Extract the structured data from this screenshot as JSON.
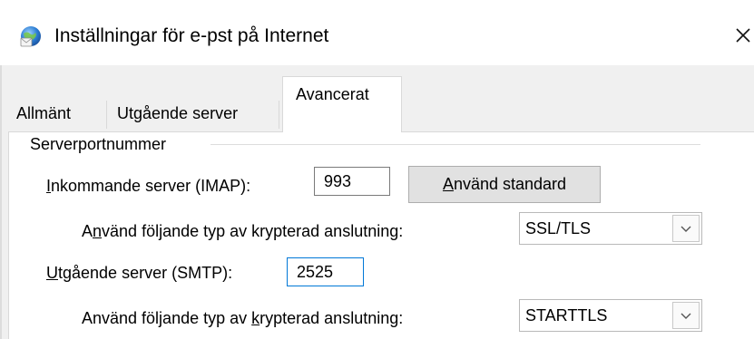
{
  "window": {
    "title": "Inställningar för e-pst på Internet",
    "icon": "globe-mail-icon",
    "close_glyph": "✕"
  },
  "tabs": [
    {
      "label": "Allmänt",
      "active": false
    },
    {
      "label": "Utgående server",
      "active": false
    },
    {
      "label": "Avancerat",
      "active": true
    }
  ],
  "group": {
    "label": "Serverportnummer"
  },
  "incoming": {
    "label_ul": "I",
    "label_rest": "nkommande server (IMAP):",
    "port": "993",
    "default_button_ul": "A",
    "default_button_rest": "nvänd standard",
    "encryption_label_pre": "A",
    "encryption_label_ul": "n",
    "encryption_label_post": "vänd följande typ av krypterad anslutning:",
    "encryption_value": "SSL/TLS"
  },
  "outgoing": {
    "label_ul": "U",
    "label_rest": "tgående server (SMTP):",
    "port": "2525",
    "encryption_label_pre": "Använd följande typ av ",
    "encryption_label_ul": "k",
    "encryption_label_post": "rypterad anslutning:",
    "encryption_value": "STARTTLS"
  },
  "colors": {
    "focus_border": "#0078d7",
    "panel_bg": "#ffffff",
    "dialog_bg": "#f0f0f0"
  }
}
